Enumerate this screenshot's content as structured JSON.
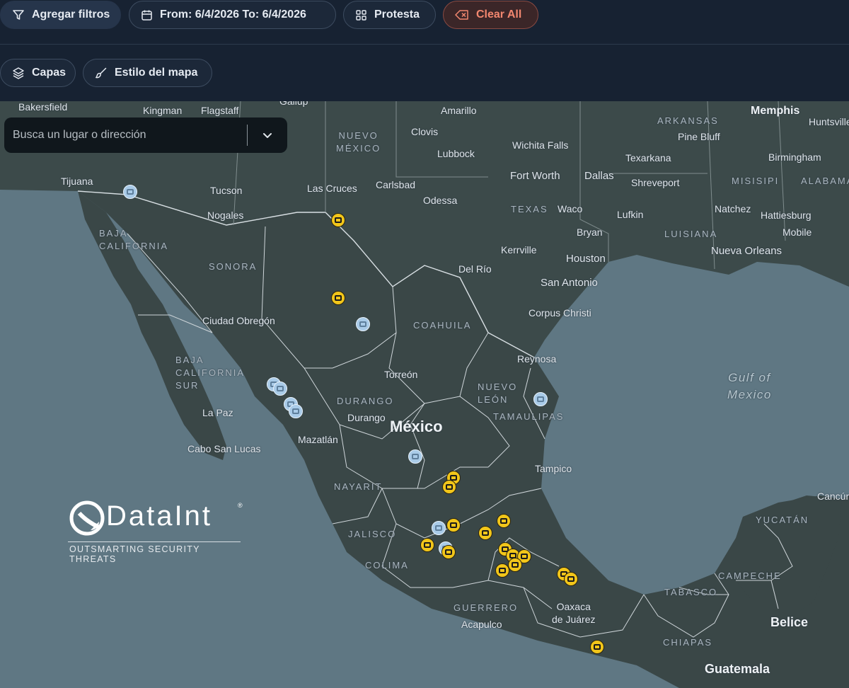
{
  "toolbar": {
    "add_filters": "Agregar filtros",
    "date_range": "From: 6/4/2026 To: 6/4/2026",
    "category": "Protesta",
    "clear_all": "Clear All",
    "layers": "Capas",
    "map_style": "Estilo del mapa"
  },
  "search": {
    "placeholder": "Busca un lugar o dirección"
  },
  "map": {
    "cities": {
      "bakersfield": "Bakersfield",
      "kingman": "Kingman",
      "flagstaff": "Flagstaff",
      "gallup": "Gallup",
      "amarillo": "Amarillo",
      "memphis": "Memphis",
      "huntsville": "Huntsville",
      "clovis": "Clovis",
      "pine_bluff": "Pine Bluff",
      "lubbock": "Lubbock",
      "wichita_falls": "Wichita Falls",
      "texarkana": "Texarkana",
      "birmingham": "Birmingham",
      "tijuana": "Tijuana",
      "tucson": "Tucson",
      "las_cruces": "Las Cruces",
      "carlsbad": "Carlsbad",
      "fort_worth": "Fort Worth",
      "dallas": "Dallas",
      "shreveport": "Shreveport",
      "nogales": "Nogales",
      "odessa": "Odessa",
      "natchez": "Natchez",
      "hattiesburg": "Hattiesburg",
      "waco": "Waco",
      "lufkin": "Lufkin",
      "mobile": "Mobile",
      "bryan": "Bryan",
      "kerrville": "Kerrville",
      "houston": "Houston",
      "nueva_orleans": "Nueva Orleans",
      "del_rio": "Del Río",
      "san_antonio": "San Antonio",
      "corpus_christi": "Corpus Christi",
      "ciudad_obregon": "Ciudad Obregón",
      "reynosa": "Reynosa",
      "torreon": "Torreón",
      "la_paz": "La Paz",
      "durango": "Durango",
      "cabo_san_lucas": "Cabo San Lucas",
      "mazatlan": "Mazatlán",
      "tampico": "Tampico",
      "acapulco": "Acapulco",
      "oaxaca": "Oaxaca\nde Juárez",
      "belice": "Belice",
      "guatemala": "Guatemala",
      "cancun": "Cancún"
    },
    "regions": {
      "nuevo_mexico": "NUEVO\nMÉXICO",
      "arkansas": "ARKANSAS",
      "misisipi": "MISISIPI",
      "alabama": "ALABAMA",
      "texas": "TEXAS",
      "luisiana": "LUISIANA",
      "baja_california": "BAJA\nCALIFORNIA",
      "sonora": "SONORA",
      "coahuila": "COAHUILA",
      "baja_california_sur": "BAJA\nCALIFORNIA\nSUR",
      "nuevo_leon": "NUEVO\nLEÓN",
      "durango_state": "DURANGO",
      "tamaulipas": "TAMAULIPAS",
      "nayarit": "NAYARIT",
      "jalisco": "JALISCO",
      "colima": "COLIMA",
      "yucatan": "YUCATÁN",
      "campeche": "CAMPECHE",
      "tabasco": "TABASCO",
      "guerrero": "GUERRERO",
      "chiapas": "CHIAPAS"
    },
    "country": "México",
    "sea": "Gulf of\nMexico",
    "markers": [
      {
        "type": "protest",
        "color": "#f2c61a"
      },
      {
        "type": "other",
        "color": "#a9cbe8"
      }
    ]
  },
  "brand": {
    "name": "DataInt",
    "registered": "®",
    "tagline": "OUTSMARTING SECURITY THREATS"
  }
}
